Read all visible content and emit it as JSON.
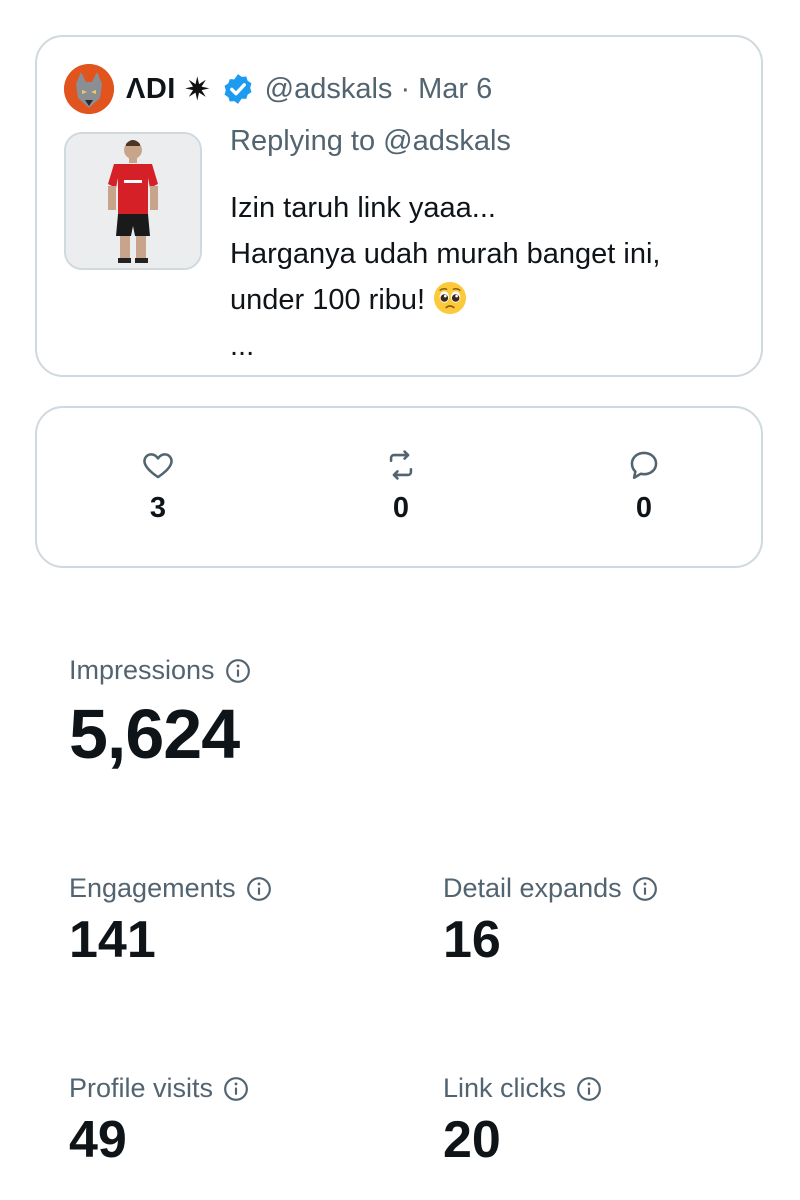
{
  "tweet": {
    "display_name": "ΛDI",
    "star_glyph": "✷",
    "handle": "@adskals",
    "separator": "·",
    "date": "Mar 6",
    "replying_to": "Replying to @adskals",
    "lines": [
      "Izin taruh link yaaa...",
      "Harganya udah murah banget ini,",
      "under 100 ribu!",
      "..."
    ],
    "icons": [
      "avatar",
      "verified-badge-icon",
      "pleading-face-emoji",
      "product-thumbnail"
    ]
  },
  "actions": {
    "likes": {
      "icon": "heart-icon",
      "count": "3"
    },
    "reposts": {
      "icon": "repost-icon",
      "count": "0"
    },
    "replies": {
      "icon": "reply-icon",
      "count": "0"
    }
  },
  "metrics": {
    "impressions": {
      "label": "Impressions",
      "value": "5,624"
    },
    "engagements": {
      "label": "Engagements",
      "value": "141"
    },
    "detail_expands": {
      "label": "Detail expands",
      "value": "16"
    },
    "profile_visits": {
      "label": "Profile visits",
      "value": "49"
    },
    "link_clicks": {
      "label": "Link clicks",
      "value": "20"
    }
  },
  "colors": {
    "text": "#0f1419",
    "secondary": "#536471",
    "border": "#cfd9de",
    "verified": "#1d9bf0"
  }
}
